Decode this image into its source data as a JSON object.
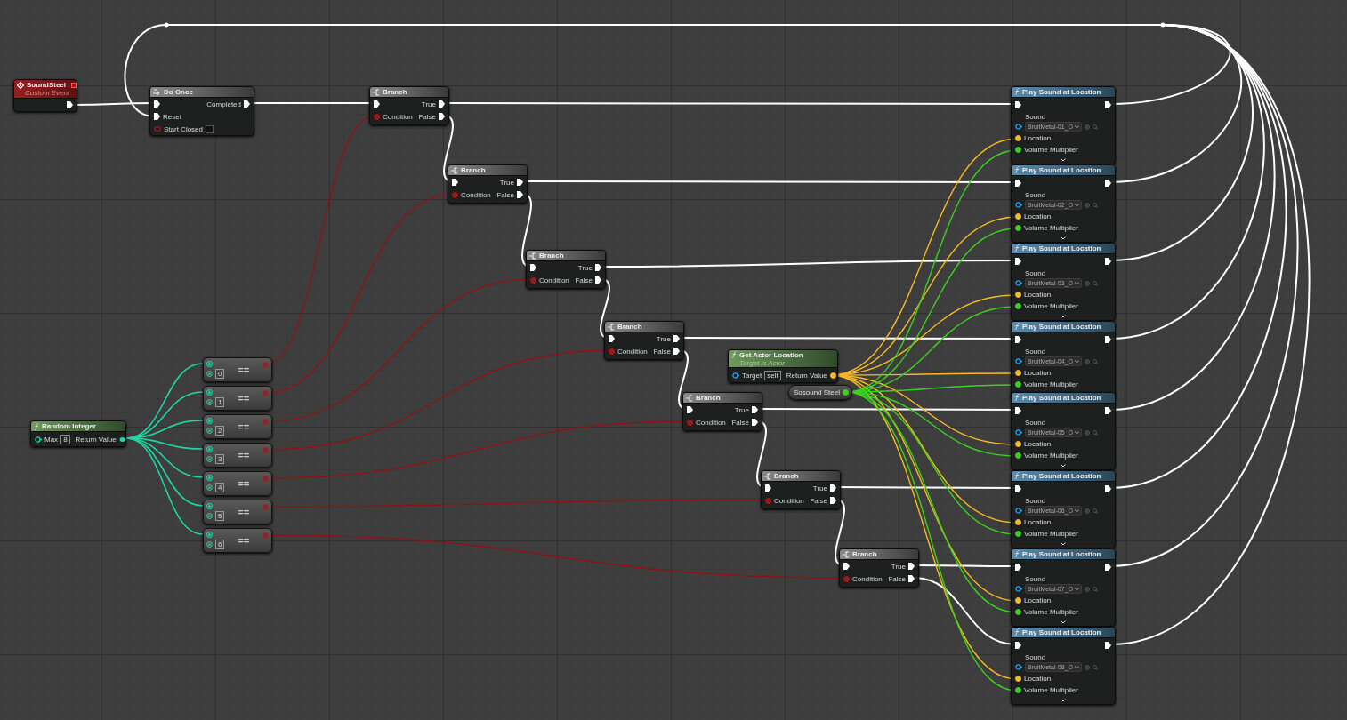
{
  "event": {
    "title": "SoundSteel",
    "subtitle": "Custom Event"
  },
  "do_once": {
    "title": "Do Once",
    "completed_label": "Completed",
    "reset_label": "Reset",
    "start_closed_label": "Start Closed",
    "start_closed": false
  },
  "random_integer": {
    "title": "Random Integer",
    "max_label": "Max",
    "max_value": "8",
    "return_label": "Return Value"
  },
  "equals_nodes": [
    {
      "operator": "==",
      "value": "0"
    },
    {
      "operator": "==",
      "value": "1"
    },
    {
      "operator": "==",
      "value": "2"
    },
    {
      "operator": "==",
      "value": "3"
    },
    {
      "operator": "==",
      "value": "4"
    },
    {
      "operator": "==",
      "value": "5"
    },
    {
      "operator": "==",
      "value": "6"
    }
  ],
  "branches": [
    {
      "title": "Branch",
      "true_label": "True",
      "false_label": "False",
      "condition_label": "Condition"
    },
    {
      "title": "Branch",
      "true_label": "True",
      "false_label": "False",
      "condition_label": "Condition"
    },
    {
      "title": "Branch",
      "true_label": "True",
      "false_label": "False",
      "condition_label": "Condition"
    },
    {
      "title": "Branch",
      "true_label": "True",
      "false_label": "False",
      "condition_label": "Condition"
    },
    {
      "title": "Branch",
      "true_label": "True",
      "false_label": "False",
      "condition_label": "Condition"
    },
    {
      "title": "Branch",
      "true_label": "True",
      "false_label": "False",
      "condition_label": "Condition"
    },
    {
      "title": "Branch",
      "true_label": "True",
      "false_label": "False",
      "condition_label": "Condition"
    }
  ],
  "get_actor_location": {
    "title": "Get Actor Location",
    "subtitle": "Target is Actor",
    "target_label": "Target",
    "target_value": "self",
    "return_label": "Return Value"
  },
  "variable": {
    "name": "Sosound Steel"
  },
  "play_sound_nodes": [
    {
      "title": "Play Sound at Location",
      "sound_label": "Sound",
      "sound_value": "BruitMetal-01_O",
      "location_label": "Location",
      "volume_label": "Volume Multiplier"
    },
    {
      "title": "Play Sound at Location",
      "sound_label": "Sound",
      "sound_value": "BruitMetal-02_O",
      "location_label": "Location",
      "volume_label": "Volume Multiplier"
    },
    {
      "title": "Play Sound at Location",
      "sound_label": "Sound",
      "sound_value": "BruitMetal-03_O",
      "location_label": "Location",
      "volume_label": "Volume Multiplier"
    },
    {
      "title": "Play Sound at Location",
      "sound_label": "Sound",
      "sound_value": "BruitMetal-04_O",
      "location_label": "Location",
      "volume_label": "Volume Multiplier"
    },
    {
      "title": "Play Sound at Location",
      "sound_label": "Sound",
      "sound_value": "BruitMetal-05_O",
      "location_label": "Location",
      "volume_label": "Volume Multiplier"
    },
    {
      "title": "Play Sound at Location",
      "sound_label": "Sound",
      "sound_value": "BruitMetal-06_O",
      "location_label": "Location",
      "volume_label": "Volume Multiplier"
    },
    {
      "title": "Play Sound at Location",
      "sound_label": "Sound",
      "sound_value": "BruitMetal-07_O",
      "location_label": "Location",
      "volume_label": "Volume Multiplier"
    },
    {
      "title": "Play Sound at Location",
      "sound_label": "Sound",
      "sound_value": "BruitMetal-08_O",
      "location_label": "Location",
      "volume_label": "Volume Multiplier"
    }
  ]
}
